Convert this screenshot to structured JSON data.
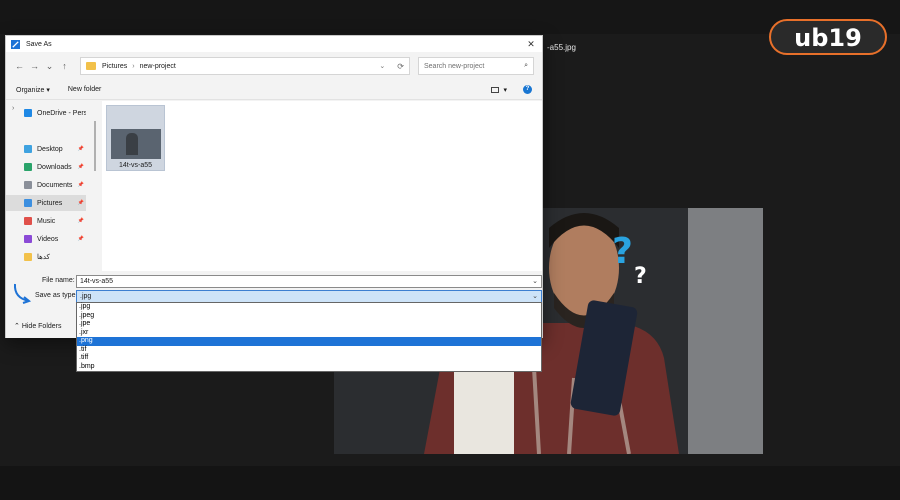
{
  "background": {
    "filename_text": "-a55.jpg",
    "logo_text": "ub۱۹"
  },
  "dialog": {
    "title": "Save As",
    "close": "✕",
    "nav": {
      "back": "←",
      "forward": "→",
      "recent": "⌄",
      "up": "↑"
    },
    "breadcrumb": [
      "Pictures",
      "new-project"
    ],
    "search_placeholder": "Search new-project",
    "toolbar": {
      "organize": "Organize ▾",
      "new_folder": "New folder",
      "view_dd": "▾",
      "help": "?"
    },
    "sidebar": [
      {
        "label": "OneDrive - Person",
        "icon": "cloud-icon",
        "color": "#1e88e5",
        "pinned": false,
        "selected": false
      },
      {
        "label": "Desktop",
        "icon": "desktop-icon",
        "color": "#3ea2e0",
        "pinned": true,
        "selected": false
      },
      {
        "label": "Downloads",
        "icon": "download-icon",
        "color": "#2aa36a",
        "pinned": true,
        "selected": false
      },
      {
        "label": "Documents",
        "icon": "documents-icon",
        "color": "#8a8f99",
        "pinned": true,
        "selected": false
      },
      {
        "label": "Pictures",
        "icon": "pictures-icon",
        "color": "#3c8fe0",
        "pinned": true,
        "selected": true
      },
      {
        "label": "Music",
        "icon": "music-icon",
        "color": "#e0504a",
        "pinned": true,
        "selected": false
      },
      {
        "label": "Videos",
        "icon": "videos-icon",
        "color": "#8b4ad6",
        "pinned": true,
        "selected": false
      },
      {
        "label": "کدها",
        "icon": "folder-icon",
        "color": "#f2c14a",
        "pinned": false,
        "selected": false
      }
    ],
    "file": {
      "name": "14t-vs-a55"
    },
    "file_name_label": "File name:",
    "file_name_value": "14t-vs-a55",
    "save_type_label": "Save as type:",
    "save_type_value": ".jpg",
    "hide_folders": "Hide Folders",
    "type_options": [
      ".jpg",
      ".jpeg",
      ".jpe",
      ".jxr",
      ".png",
      ".tif",
      ".tiff",
      ".bmp"
    ],
    "selected_type_index": 4
  }
}
